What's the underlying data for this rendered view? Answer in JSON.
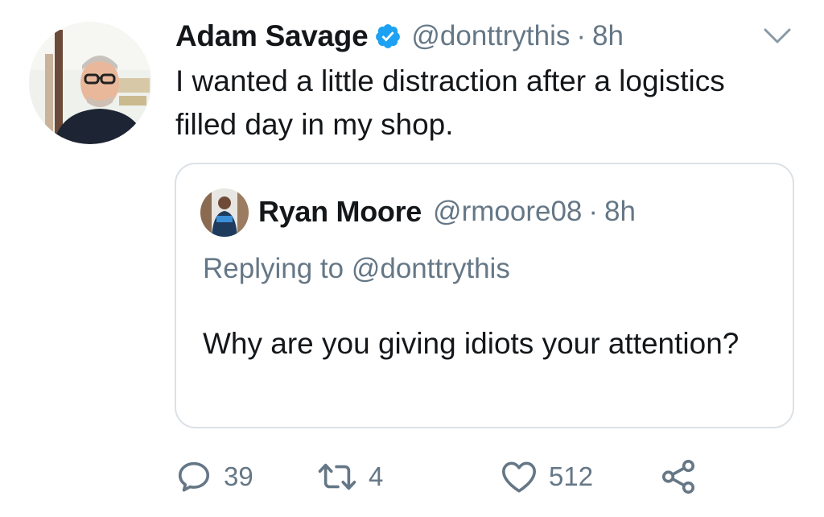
{
  "tweet": {
    "author": {
      "display_name": "Adam Savage",
      "handle": "@donttrythis",
      "verified_icon": "verified-badge-icon",
      "verified_color": "#1da1f2"
    },
    "separator": "·",
    "time": "8h",
    "text": "I wanted a little distraction after a logistics filled day in my shop.",
    "quoted": {
      "author": {
        "display_name": "Ryan Moore",
        "handle": "@rmoore08"
      },
      "separator": "·",
      "time": "8h",
      "replying_to": "Replying to @donttrythis",
      "text": "Why are you giving idiots your attention?"
    },
    "actions": {
      "reply": {
        "icon": "reply-icon",
        "count": "39"
      },
      "retweet": {
        "icon": "retweet-icon",
        "count": "4"
      },
      "like": {
        "icon": "heart-icon",
        "count": "512"
      },
      "share": {
        "icon": "share-icon"
      }
    },
    "colors": {
      "text": "#14171a",
      "secondary": "#657786",
      "border": "#dbe1e6"
    }
  }
}
